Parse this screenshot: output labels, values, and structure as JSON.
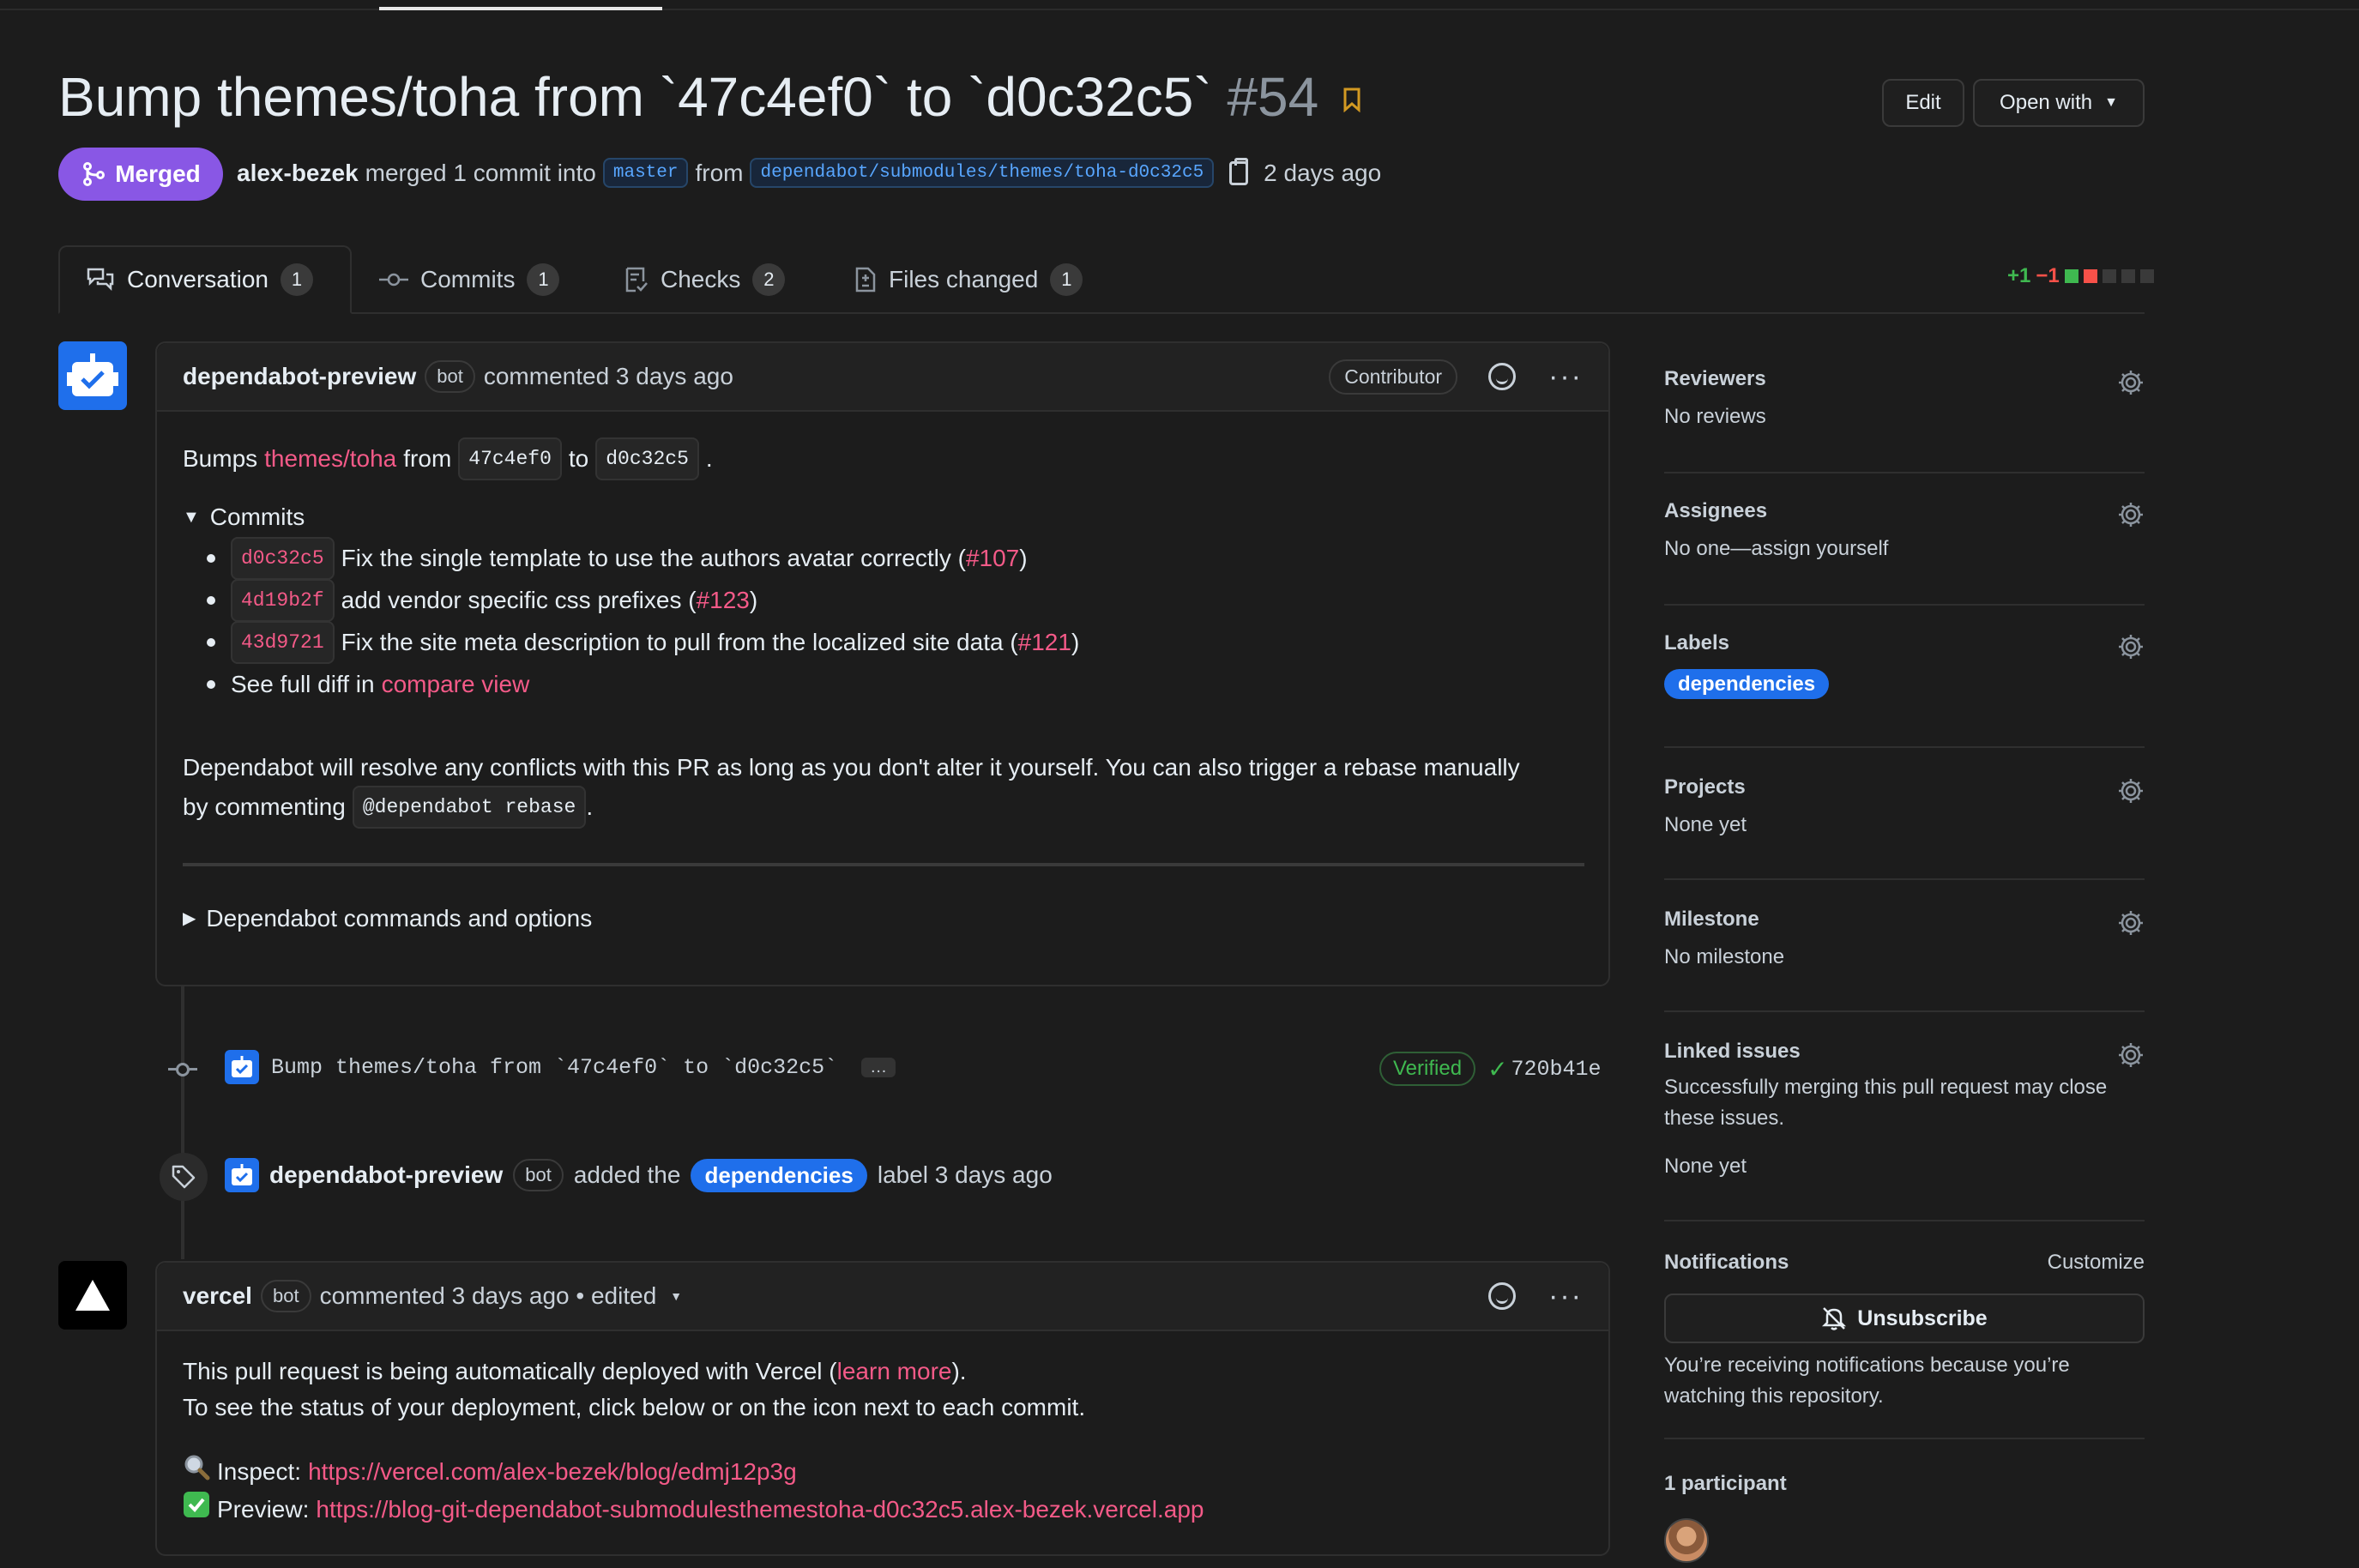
{
  "pr": {
    "title": "Bump themes/toha from `47c4ef0` to `d0c32c5`",
    "number": "#54",
    "status": "Merged",
    "author": "alex-bezek",
    "merge_text": "merged 1 commit into",
    "base_branch": "master",
    "from_text": "from",
    "head_branch": "dependabot/submodules/themes/toha-d0c32c5",
    "time": "2 days ago"
  },
  "header_buttons": {
    "edit": "Edit",
    "open_with": "Open with"
  },
  "tabs": [
    {
      "label": "Conversation",
      "count": "1"
    },
    {
      "label": "Commits",
      "count": "1"
    },
    {
      "label": "Checks",
      "count": "2"
    },
    {
      "label": "Files changed",
      "count": "1"
    }
  ],
  "diffstat": {
    "additions": "+1",
    "deletions": "−1"
  },
  "comment1": {
    "author": "dependabot-preview",
    "bot": "bot",
    "action": "commented 3 days ago",
    "role": "Contributor",
    "bumps": "Bumps",
    "repo_link": "themes/toha",
    "from": "from",
    "from_sha": "47c4ef0",
    "to": "to",
    "to_sha": "d0c32c5",
    "commits_summary": "Commits",
    "commits": [
      {
        "sha": "d0c32c5",
        "text": "Fix the single template to use the authors avatar correctly (",
        "ref": "#107",
        "close": ")"
      },
      {
        "sha": "4d19b2f",
        "text": "add vendor specific css prefixes (",
        "ref": "#123",
        "close": ")"
      },
      {
        "sha": "43d9721",
        "text": "Fix the site meta description to pull from the localized site data (",
        "ref": "#121",
        "close": ")"
      }
    ],
    "full_diff_text": "See full diff in",
    "compare_link": "compare view",
    "rebase_line1": "Dependabot will resolve any conflicts with this PR as long as you don't alter it yourself. You can also trigger a rebase manually",
    "rebase_line2_pre": "by commenting",
    "rebase_cmd": "@dependabot rebase",
    "rebase_line2_post": ".",
    "options_summary": "Dependabot commands and options"
  },
  "timeline_commit": {
    "message": "Bump themes/toha from `47c4ef0` to `d0c32c5`",
    "ellipsis": "…",
    "verified": "Verified",
    "sha": "720b41e"
  },
  "timeline_label": {
    "author": "dependabot-preview",
    "bot": "bot",
    "added": "added the",
    "label": "dependencies",
    "suffix": "label 3 days ago"
  },
  "comment2": {
    "author": "vercel",
    "bot": "bot",
    "action": "commented 3 days ago • edited",
    "line1_pre": "This pull request is being automatically deployed with Vercel (",
    "learn_more": "learn more",
    "line1_post": ").",
    "line2": "To see the status of your deployment, click below or on the icon next to each commit.",
    "inspect_label": "Inspect:",
    "inspect_url": "https://vercel.com/alex-bezek/blog/edmj12p3g",
    "preview_label": "Preview:",
    "preview_url": "https://blog-git-dependabot-submodulesthemestoha-d0c32c5.alex-bezek.vercel.app"
  },
  "sidebar": {
    "reviewers": {
      "title": "Reviewers",
      "value": "No reviews"
    },
    "assignees": {
      "title": "Assignees",
      "value": "No one—assign yourself"
    },
    "labels": {
      "title": "Labels",
      "value": "dependencies"
    },
    "projects": {
      "title": "Projects",
      "value": "None yet"
    },
    "milestone": {
      "title": "Milestone",
      "value": "No milestone"
    },
    "linked": {
      "title": "Linked issues",
      "desc1": "Successfully merging this pull request may close",
      "desc2": "these issues.",
      "value": "None yet"
    },
    "notifications": {
      "title": "Notifications",
      "customize": "Customize",
      "button": "Unsubscribe",
      "desc1": "You’re receiving notifications because you’re",
      "desc2": "watching this repository."
    },
    "participants": {
      "title": "1 participant"
    }
  },
  "colors": {
    "merged": "#8957e5",
    "link": "#f45a88",
    "label": "#1f6feb",
    "verified": "#3fb950"
  }
}
